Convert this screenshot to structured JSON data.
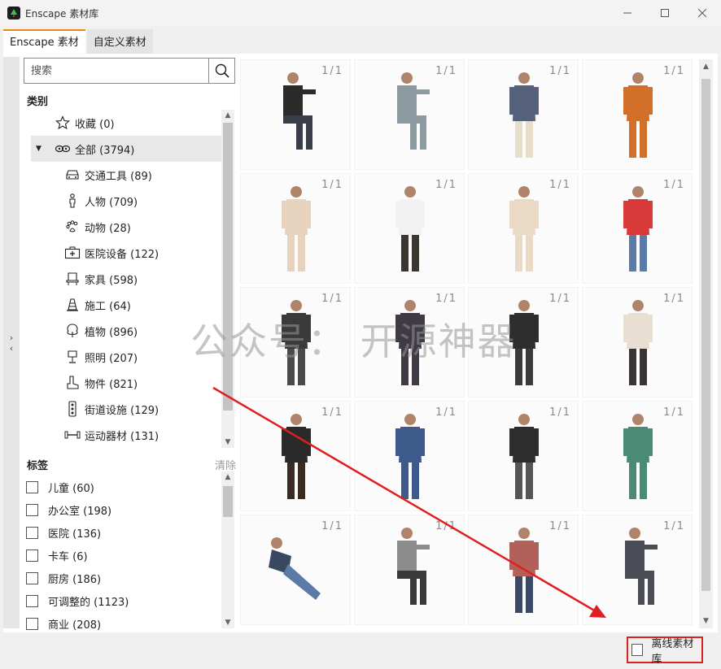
{
  "window": {
    "title": "Enscape 素材库",
    "controls": [
      "minimize",
      "maximize",
      "close"
    ]
  },
  "tabs": [
    {
      "label": "Enscape 素材",
      "active": true
    },
    {
      "label": "自定义素材",
      "active": false
    }
  ],
  "search": {
    "placeholder": "搜索"
  },
  "categories": {
    "title": "类别",
    "items": [
      {
        "label": "收藏 (0)",
        "icon": "star-icon"
      },
      {
        "label": "全部 (3794)",
        "icon": "infinity-icon",
        "selected": true,
        "expanded": true
      },
      {
        "label": "交通工具 (89)",
        "icon": "car-icon"
      },
      {
        "label": "人物 (709)",
        "icon": "person-icon"
      },
      {
        "label": "动物 (28)",
        "icon": "paw-icon"
      },
      {
        "label": "医院设备 (122)",
        "icon": "medical-kit-icon"
      },
      {
        "label": "家具 (598)",
        "icon": "chair-icon"
      },
      {
        "label": "施工 (64)",
        "icon": "traffic-cone-icon"
      },
      {
        "label": "植物 (896)",
        "icon": "tree-icon"
      },
      {
        "label": "照明 (207)",
        "icon": "lamp-icon"
      },
      {
        "label": "物件 (821)",
        "icon": "boot-icon"
      },
      {
        "label": "街道设施 (129)",
        "icon": "traffic-light-icon"
      },
      {
        "label": "运动器材 (131)",
        "icon": "dumbbell-icon"
      }
    ]
  },
  "tags": {
    "title": "标签",
    "clear_label": "清除",
    "items": [
      {
        "label": "儿童 (60)"
      },
      {
        "label": "办公室 (198)"
      },
      {
        "label": "医院 (136)"
      },
      {
        "label": "卡车 (6)"
      },
      {
        "label": "厨房 (186)"
      },
      {
        "label": "可调整的 (1123)"
      },
      {
        "label": "商业 (208)"
      }
    ]
  },
  "assets": [
    {
      "count": "1/1",
      "pose": "sitting",
      "top": "#2b2b2b",
      "bottom": "#3a3d4a"
    },
    {
      "count": "1/1",
      "pose": "sitting",
      "top": "#8d9aa0",
      "bottom": "#8d9aa0"
    },
    {
      "count": "1/1",
      "pose": "standing",
      "top": "#55607a",
      "bottom": "#e7ddc8"
    },
    {
      "count": "1/1",
      "pose": "standing",
      "top": "#d2702a",
      "bottom": "#d2702a"
    },
    {
      "count": "1/1",
      "pose": "standing",
      "top": "#e6d2bd",
      "bottom": "#e6d2bd"
    },
    {
      "count": "1/1",
      "pose": "standing",
      "top": "#f2f2f2",
      "bottom": "#3b3630"
    },
    {
      "count": "1/1",
      "pose": "standing",
      "top": "#ead9c4",
      "bottom": "#ead9c4"
    },
    {
      "count": "1/1",
      "pose": "standing",
      "top": "#d83a3a",
      "bottom": "#5a7aa8"
    },
    {
      "count": "1/1",
      "pose": "standing",
      "top": "#3a3a3a",
      "bottom": "#4a4a4a"
    },
    {
      "count": "1/1",
      "pose": "standing",
      "top": "#3f3a44",
      "bottom": "#3f3a44"
    },
    {
      "count": "1/1",
      "pose": "standing",
      "top": "#2e2e2e",
      "bottom": "#3b3b3b"
    },
    {
      "count": "1/1",
      "pose": "standing",
      "top": "#e8dfd2",
      "bottom": "#3a3434"
    },
    {
      "count": "1/1",
      "pose": "standing",
      "top": "#2a2a2a",
      "bottom": "#3a2a22"
    },
    {
      "count": "1/1",
      "pose": "standing",
      "top": "#3d5a8a",
      "bottom": "#3d5a8a"
    },
    {
      "count": "1/1",
      "pose": "standing",
      "top": "#2d2d2d",
      "bottom": "#555555"
    },
    {
      "count": "1/1",
      "pose": "standing",
      "top": "#4b8a74",
      "bottom": "#4b8a74"
    },
    {
      "count": "1/1",
      "pose": "reclining",
      "top": "#3a4860",
      "bottom": "#5c7aa6"
    },
    {
      "count": "1/1",
      "pose": "sitting",
      "top": "#8c8c8c",
      "bottom": "#3a3a3a"
    },
    {
      "count": "1/1",
      "pose": "standing",
      "top": "#b2605a",
      "bottom": "#3b4a66"
    },
    {
      "count": "1/1",
      "pose": "sitting",
      "top": "#4a4d55",
      "bottom": "#4a4d55"
    }
  ],
  "offline": {
    "label": "离线素材库",
    "checked": false
  },
  "overlay": {
    "watermark": "公众号： 开源神器"
  },
  "colors": {
    "accent": "#e8861a",
    "highlight_box": "#e02020",
    "arrow": "#e02020"
  }
}
